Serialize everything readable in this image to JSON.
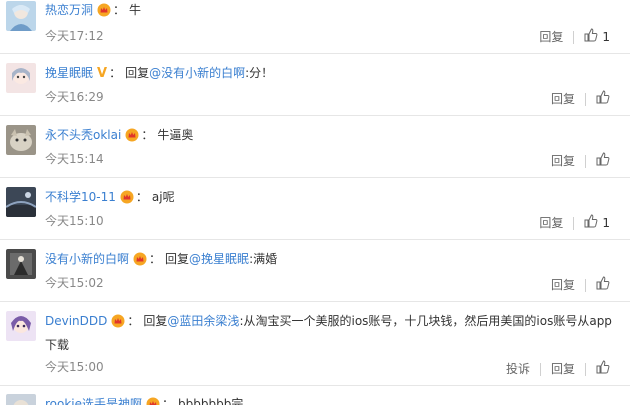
{
  "comments": [
    {
      "user": "热恋万洞",
      "verified": "crown",
      "reply_label": "",
      "mention": "",
      "text": "牛",
      "time": "今天17:12",
      "report": "",
      "reply": "回复",
      "likes": "1"
    },
    {
      "user": "挽星眠眠",
      "verified": "v",
      "reply_label": "回复",
      "mention": "@没有小新的白啊",
      "text": ":分！",
      "time": "今天16:29",
      "report": "",
      "reply": "回复",
      "likes": ""
    },
    {
      "user": "永不头秃oklai",
      "verified": "crown",
      "reply_label": "",
      "mention": "",
      "text": "牛逼奥",
      "time": "今天15:14",
      "report": "",
      "reply": "回复",
      "likes": ""
    },
    {
      "user": "不科学10-11",
      "verified": "crown",
      "reply_label": "",
      "mention": "",
      "text": "aj呢",
      "time": "今天15:10",
      "report": "",
      "reply": "回复",
      "likes": "1"
    },
    {
      "user": "没有小新的白啊",
      "verified": "crown",
      "reply_label": "回复",
      "mention": "@挽星眠眠",
      "text": ":满婚",
      "time": "今天15:02",
      "report": "",
      "reply": "回复",
      "likes": ""
    },
    {
      "user": "DevinDDD",
      "verified": "crown",
      "reply_label": "回复",
      "mention": "@蓝田余梁浅",
      "text": ":从淘宝买一个美服的ios账号，十几块钱，然后用美国的ios账号从app下载",
      "time": "今天15:00",
      "report": "投诉",
      "reply": "回复",
      "likes": ""
    },
    {
      "user": "rookie选手是神啊",
      "verified": "crown",
      "reply_label": "",
      "mention": "",
      "text": "bbbbbbb完",
      "time": "",
      "report": "",
      "reply": "",
      "likes": ""
    }
  ],
  "colors": {
    "accent": "#eb7350",
    "link": "#3a7fd0",
    "crown": "#f6a623"
  }
}
